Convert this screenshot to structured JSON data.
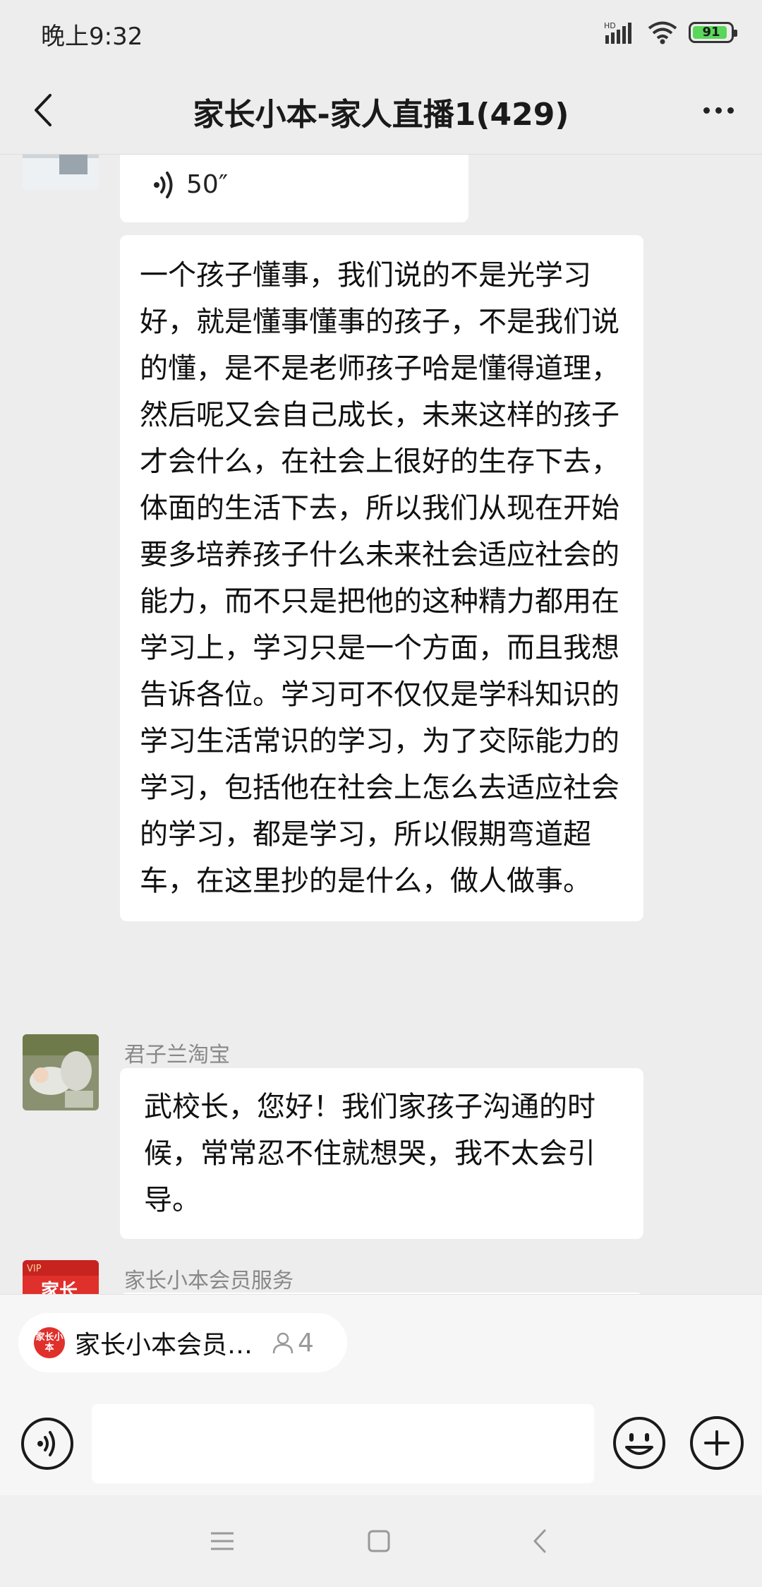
{
  "status": {
    "time": "晚上9:32",
    "network": "HD",
    "battery": "91"
  },
  "header": {
    "title": "家长小本-家人直播1(429)"
  },
  "messages": [
    {
      "type": "voice",
      "duration": "50″"
    },
    {
      "type": "text",
      "text": "一个孩子懂事，我们说的不是光学习好，就是懂事懂事的孩子，不是我们说的懂，是不是老师孩子哈是懂得道理，然后呢又会自己成长，未来这样的孩子才会什么，在社会上很好的生存下去，体面的生活下去，所以我们从现在开始要多培养孩子什么未来社会适应社会的能力，而不只是把他的这种精力都用在学习上，学习只是一个方面，而且我想告诉各位。学习可不仅仅是学科知识的学习生活常识的学习，为了交际能力的学习，包括他在社会上怎么去适应社会的学习，都是学习，所以假期弯道超车，在这里抄的是什么，做人做事。"
    },
    {
      "type": "text",
      "sender": "君子兰淘宝",
      "text": "武校长，您好！我们家孩子沟通的时候，常常忍不住就想哭，我不太会引导。"
    },
    {
      "type": "text",
      "sender": "家长小本会员服务",
      "avatar_badge": "VIP",
      "avatar_text": "家长"
    }
  ],
  "service_chip": {
    "logo_text": "家长小本",
    "label": "家长小本会员…",
    "members": "4"
  }
}
